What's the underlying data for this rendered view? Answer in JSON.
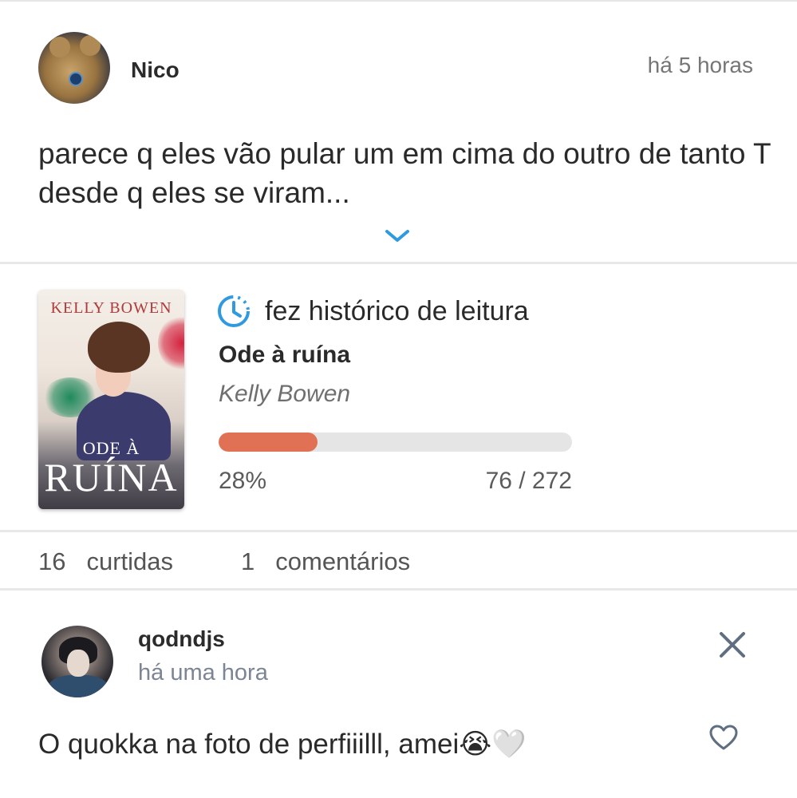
{
  "post": {
    "author": "Nico",
    "time": "há 5 horas",
    "text": "parece q eles vão pular um em cima do outro de tanto T desde q eles se viram..."
  },
  "activity": {
    "label": "fez histórico de leitura",
    "book": {
      "title": "Ode à ruína",
      "author": "Kelly Bowen",
      "cover_author": "KELLY BOWEN",
      "cover_title_line1": "ODE À",
      "cover_title_line2": "RUÍNA"
    },
    "progress": {
      "percent_label": "28%",
      "fraction": 0.28,
      "pages_label": "76 / 272"
    }
  },
  "stats": {
    "likes_count": "16",
    "likes_label": "curtidas",
    "comments_count": "1",
    "comments_label": "comentários"
  },
  "comment": {
    "author": "qodndjs",
    "time": "há uma hora",
    "text": "O quokka na foto de perfiiilll, amei",
    "emojis": "😭🤍"
  },
  "colors": {
    "accent_blue": "#2f9ae0",
    "progress_fill": "#e07155",
    "progress_track": "#e5e5e5"
  },
  "icons": {
    "expand": "chevron-down-icon",
    "history": "history-clock-icon",
    "close": "close-icon",
    "like": "heart-outline-icon"
  }
}
